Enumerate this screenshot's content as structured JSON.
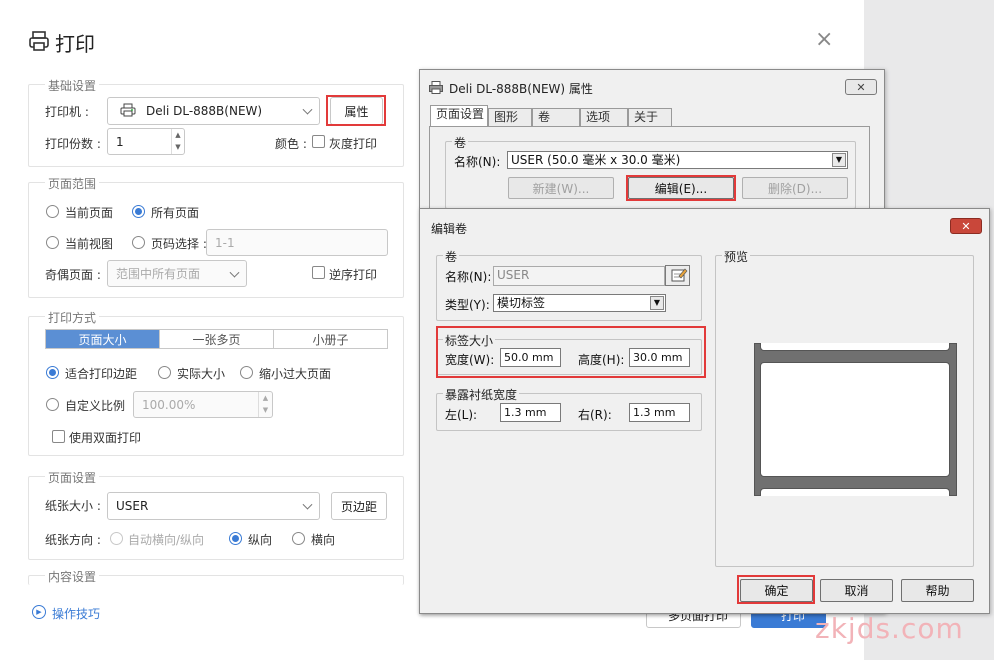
{
  "print": {
    "title": "打印",
    "close_glyph": "×",
    "basic": {
      "group_title": "基础设置",
      "printer_label": "打印机 :",
      "printer_value": "Deli DL-888B(NEW)",
      "properties_button": "属性",
      "copies_label": "打印份数 :",
      "copies_value": "1",
      "color_label": "颜色 :",
      "grayscale_label": "灰度打印"
    },
    "range": {
      "group_title": "页面范围",
      "current_page": "当前页面",
      "all_pages": "所有页面",
      "current_view": "当前视图",
      "page_select": "页码选择 :",
      "page_select_placeholder": "1-1",
      "odd_even_label": "奇偶页面 :",
      "odd_even_value": "范围中所有页面",
      "reverse_label": "逆序打印"
    },
    "mode": {
      "group_title": "打印方式",
      "tabs": [
        "页面大小",
        "一张多页",
        "小册子"
      ],
      "fit_margins": "适合打印边距",
      "actual_size": "实际大小",
      "shrink_large": "缩小过大页面",
      "custom_scale": "自定义比例",
      "scale_value": "100.00%",
      "duplex": "使用双面打印"
    },
    "page_setup": {
      "group_title": "页面设置",
      "paper_size_label": "纸张大小 :",
      "paper_size_value": "USER",
      "margin_button": "页边距",
      "orientation_label": "纸张方向 :",
      "auto": "自动横向/纵向",
      "portrait": "纵向",
      "landscape": "横向"
    },
    "content": {
      "group_title": "内容设置"
    },
    "tips_link": "操作技巧",
    "footer_partial_left": "多页面打印",
    "footer_partial_right": "打印"
  },
  "props_dialog": {
    "title": "Deli DL-888B(NEW) 属性",
    "close_glyph": "✕",
    "tabs": [
      "页面设置",
      "图形",
      "卷",
      "选项",
      "关于"
    ],
    "group_label": "卷",
    "name_label": "名称(N):",
    "name_value": "USER (50.0 毫米 x 30.0 毫米)",
    "new_button": "新建(W)...",
    "edit_button": "编辑(E)...",
    "delete_button": "删除(D)..."
  },
  "edit_dialog": {
    "title": "编辑卷",
    "close_glyph": "✕",
    "roll_group": "卷",
    "name_label": "名称(N):",
    "name_value": "USER",
    "type_label": "类型(Y):",
    "type_value": "模切标签",
    "label_size_group": "标签大小",
    "width_label": "宽度(W):",
    "width_value": "50.0 mm",
    "height_label": "高度(H):",
    "height_value": "30.0 mm",
    "exposed_group": "暴露衬纸宽度",
    "left_label": "左(L):",
    "left_value": "1.3 mm",
    "right_label": "右(R):",
    "right_value": "1.3 mm",
    "preview_label": "预览",
    "ok_button": "确定",
    "cancel_button": "取消",
    "help_button": "帮助"
  },
  "watermark": "zkjds.com"
}
